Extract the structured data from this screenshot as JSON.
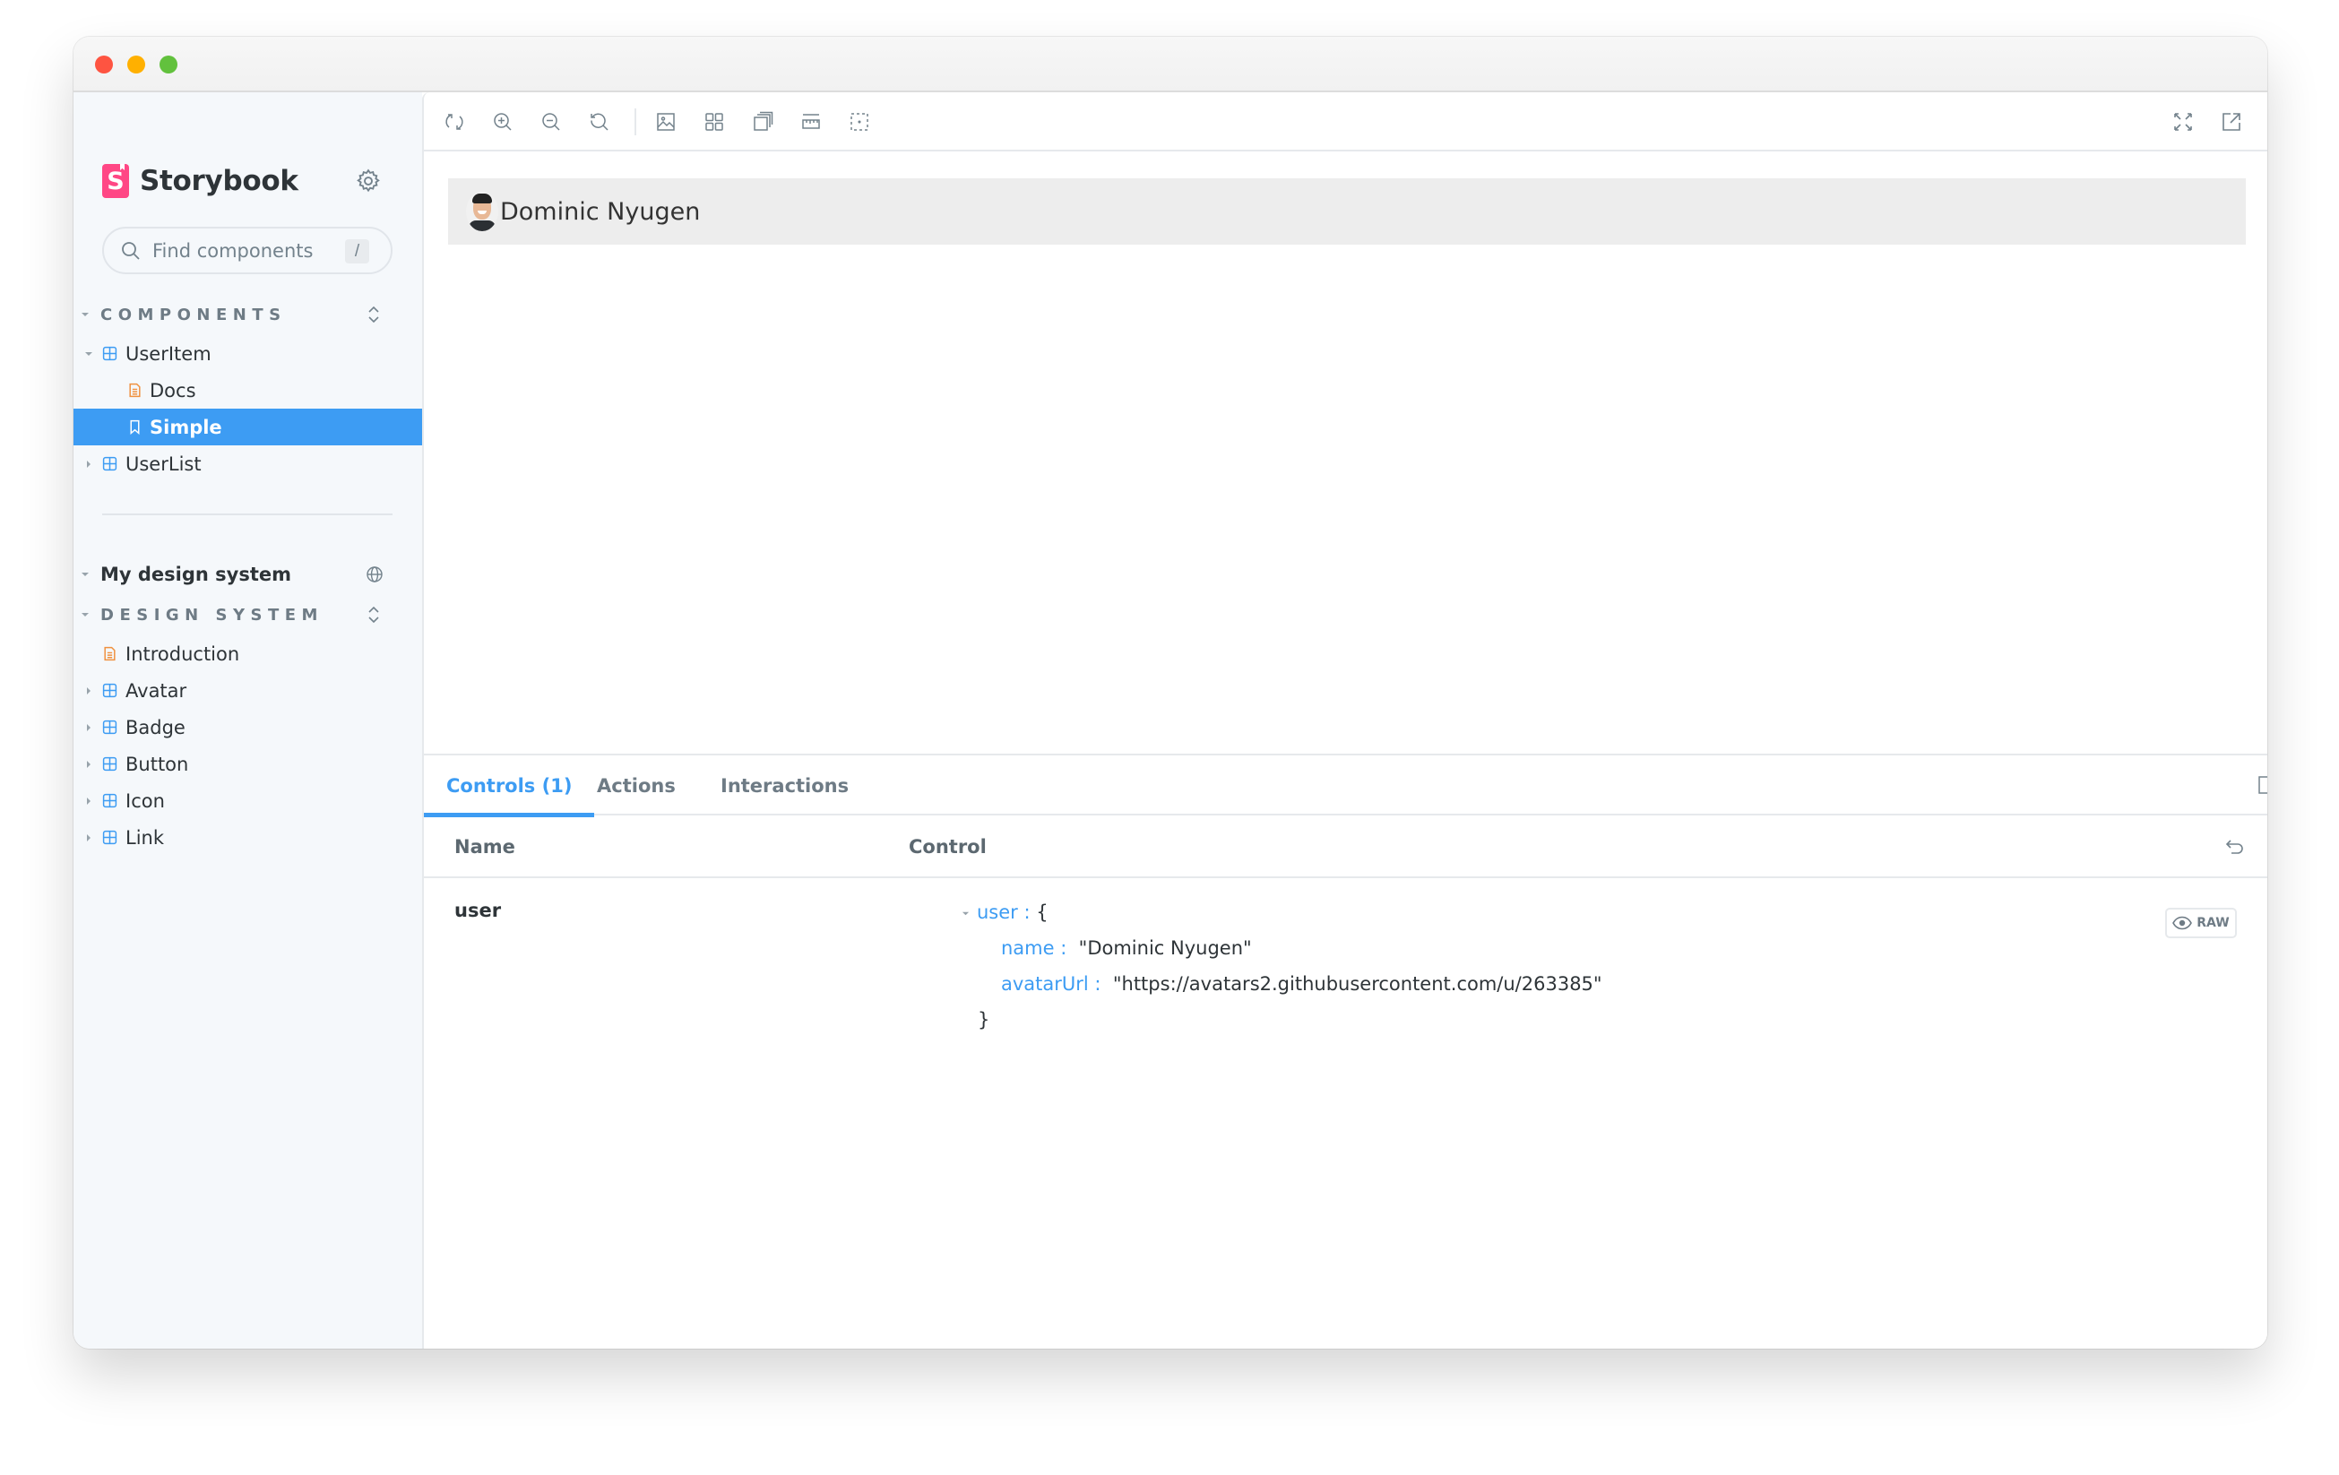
{
  "window": {
    "title_buttons": [
      "close",
      "minimize",
      "zoom"
    ]
  },
  "sidebar": {
    "brand": {
      "logo_letter": "S",
      "name": "Storybook"
    },
    "settings_icon": "gear-icon",
    "search": {
      "placeholder": "Find components",
      "value": "",
      "shortcut": "/"
    },
    "components_section": {
      "label": "COMPONENTS",
      "items": [
        {
          "label": "UserItem",
          "type": "component",
          "expanded": true
        },
        {
          "label": "Docs",
          "type": "docs"
        },
        {
          "label": "Simple",
          "type": "story",
          "selected": true
        },
        {
          "label": "UserList",
          "type": "component",
          "expanded": false
        }
      ]
    },
    "ref": {
      "label": "My design system",
      "icon": "globe-icon"
    },
    "design_system_section": {
      "label": "DESIGN SYSTEM",
      "items": [
        {
          "label": "Introduction",
          "type": "docs"
        },
        {
          "label": "Avatar",
          "type": "component"
        },
        {
          "label": "Badge",
          "type": "component"
        },
        {
          "label": "Button",
          "type": "component"
        },
        {
          "label": "Icon",
          "type": "component"
        },
        {
          "label": "Link",
          "type": "component"
        }
      ]
    }
  },
  "toolbar": {
    "left_tools": [
      "reload-icon",
      "zoom-in-icon",
      "zoom-out-icon",
      "zoom-reset-icon",
      "background-icon",
      "grid-icon",
      "viewport-icon",
      "measure-icon",
      "outline-icon"
    ],
    "right_tools": [
      "fullscreen-icon",
      "open-new-tab-icon",
      "copy-link-icon"
    ]
  },
  "preview": {
    "user": {
      "name": "Dominic Nyugen"
    }
  },
  "panel": {
    "tabs": [
      {
        "label": "Controls (1)",
        "active": true
      },
      {
        "label": "Actions",
        "active": false
      },
      {
        "label": "Interactions",
        "active": false
      }
    ],
    "columns": {
      "name": "Name",
      "control": "Control"
    },
    "rows": [
      {
        "name": "user",
        "object": {
          "key": "user",
          "open": "{",
          "close": "}",
          "entries": [
            {
              "key": "name",
              "value": "\"Dominic Nyugen\""
            },
            {
              "key": "avatarUrl",
              "value": "\"https://avatars2.githubusercontent.com/u/263385\""
            }
          ]
        },
        "raw_label": "RAW"
      }
    ]
  },
  "colors": {
    "accent": "#3d9cf3",
    "brand": "#ff4785",
    "docs_icon": "#f0913f",
    "sidebar_bg": "#f5f8fb",
    "card_bg": "#ededed"
  }
}
